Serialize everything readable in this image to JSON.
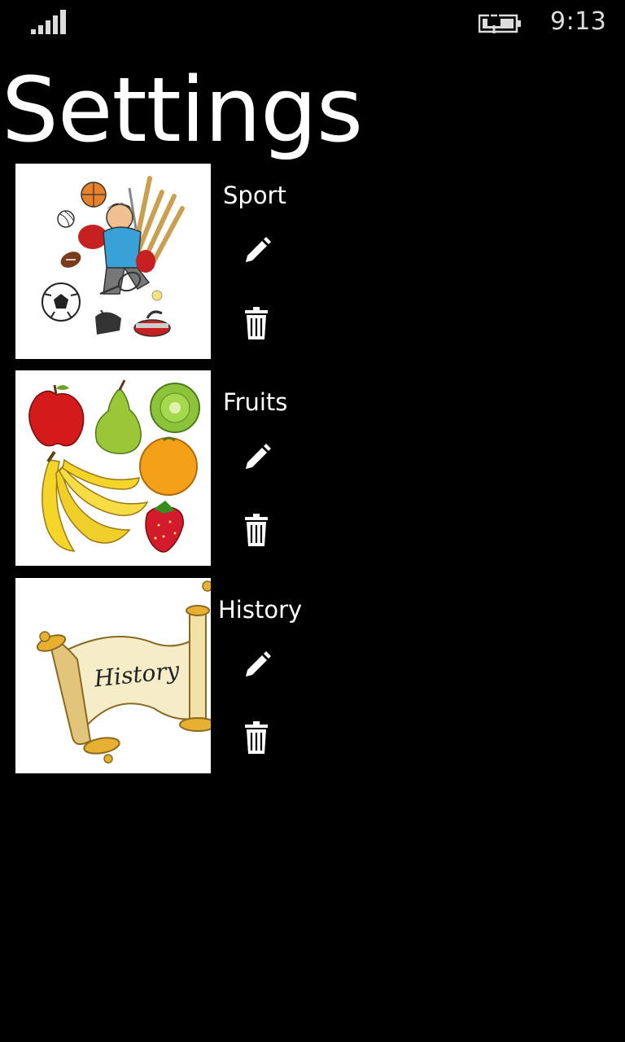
{
  "status_bar": {
    "time": "9:13",
    "signal_icon": "signal-strength-icon",
    "battery_icon": "battery-charging-icon"
  },
  "page": {
    "title": "Settings"
  },
  "categories": [
    {
      "label": "Sport",
      "image_icon": "sport-illustration",
      "edit_icon": "pencil-icon",
      "delete_icon": "trash-icon"
    },
    {
      "label": "Fruits",
      "image_icon": "fruits-illustration",
      "edit_icon": "pencil-icon",
      "delete_icon": "trash-icon"
    },
    {
      "label": "History",
      "image_icon": "history-scroll-illustration",
      "scroll_text": "History",
      "edit_icon": "pencil-icon",
      "delete_icon": "trash-icon"
    }
  ],
  "colors": {
    "background": "#000000",
    "foreground": "#ffffff"
  }
}
